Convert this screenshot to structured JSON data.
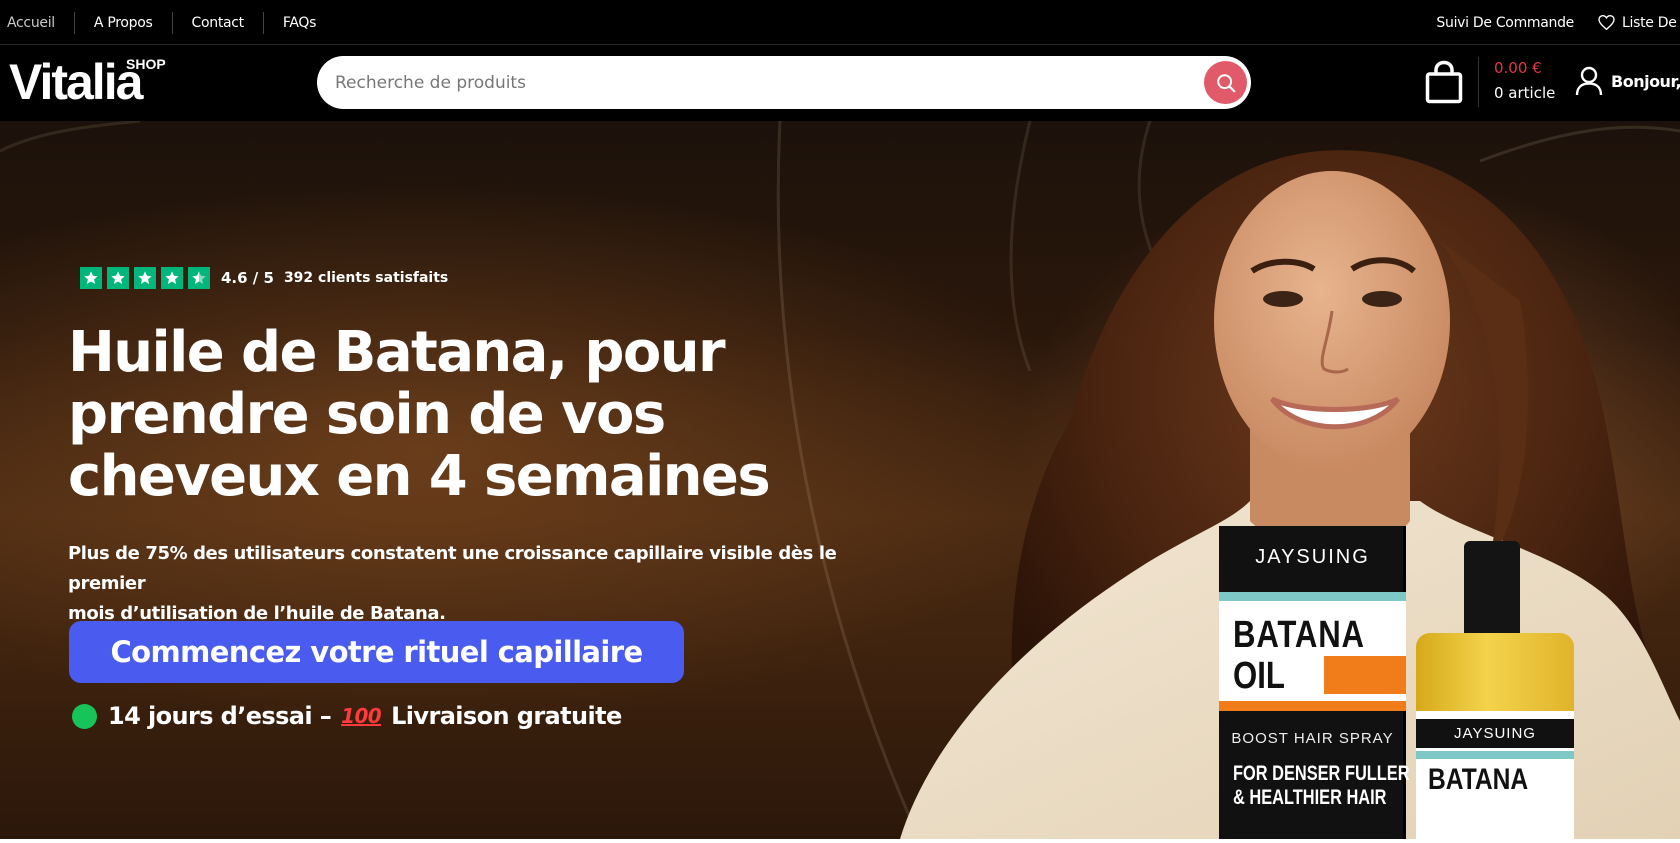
{
  "topbar": {
    "nav": [
      "Accueil",
      "A Propos",
      "Contact",
      "FAQs"
    ],
    "order_tracking": "Suivi De Commande",
    "wishlist": "Liste De"
  },
  "header": {
    "logo_text": "Vitalia",
    "logo_badge": "SHOP",
    "search_placeholder": "Recherche de produits",
    "cart_total": "0.00 €",
    "cart_count": "0 article",
    "greeting": "Bonjour,"
  },
  "hero": {
    "rating_value": 4.6,
    "rating_text": "4.6 / 5",
    "rating_count": "392 clients satisfaits",
    "title_line1": "Huile de Batana, pour",
    "title_line2": "prendre soin de vos",
    "title_line3": "cheveux en 4 semaines",
    "subtitle_line1": "Plus de 75% des utilisateurs constatent une croissance capillaire visible dès le premier",
    "subtitle_line2": "mois d’utilisation de l’huile de Batana.",
    "cta_label": "Commencez votre rituel capillaire",
    "trial_text": "14 jours d’essai –",
    "shipping_text": "Livraison gratuite",
    "hundred_badge": "100"
  },
  "product": {
    "box_brand": "JAYSUING",
    "box_name_line1": "BATANA",
    "box_name_line2": "OIL",
    "box_type": "BOOST HAIR SPRAY",
    "box_claim_line1": "FOR DENSER FULLER",
    "box_claim_line2": "& HEALTHIER HAIR",
    "bottle_brand": "JAYSUING",
    "bottle_name": "BATANA"
  },
  "colors": {
    "accent_cta": "#4a5cf0",
    "search_button": "#e05a6a",
    "cart_total": "#e2364a",
    "trustpilot_green": "#00b67a",
    "trial_dot": "#16c45a"
  }
}
